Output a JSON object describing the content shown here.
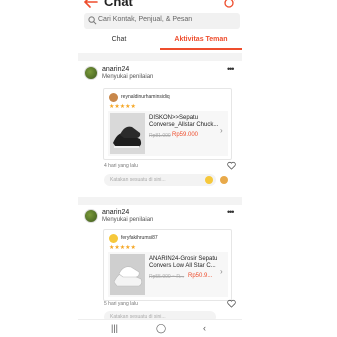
{
  "header": {
    "title": "Chat"
  },
  "search": {
    "placeholder": "Cari Kontak, Penjual, & Pesan"
  },
  "tabs": [
    {
      "label": "Chat"
    },
    {
      "label": "Aktivitas Teman"
    }
  ],
  "feed": [
    {
      "user": "anarin24",
      "action": "Menyukai penilaian",
      "reviewer": "reynaldinurhaminsidiq",
      "stars": "★★★★★",
      "product_name": "DISKON>>Sepatu Converse_Allstar Chuck...",
      "price_old": "Rp81.000",
      "price_new": "Rp59.000",
      "time": "4 hari yang lalu",
      "comment_placeholder": "Katakan sesuatu di sini..."
    },
    {
      "user": "anarin24",
      "action": "Menyukai penilaian",
      "reviewer": "feryfakihrumsi87",
      "stars": "★★★★★",
      "product_name": "ANARIN24-Grosir Sepatu Convers Low All Star C...",
      "price_old": "Rp55.900 ~ R...",
      "price_new": "Rp50.9...",
      "time": "5 hari yang lalu",
      "comment_placeholder": "Katakan sesuatu di sini..."
    }
  ],
  "colors": {
    "accent": "#ee4d2d",
    "star": "#f5a623"
  },
  "icons": {
    "back": "back-arrow-icon",
    "header_right": "notification-icon",
    "search": "search-icon",
    "more": "more-icon",
    "heart": "heart-icon",
    "nav": [
      "recents-icon",
      "home-icon",
      "back-icon"
    ]
  }
}
